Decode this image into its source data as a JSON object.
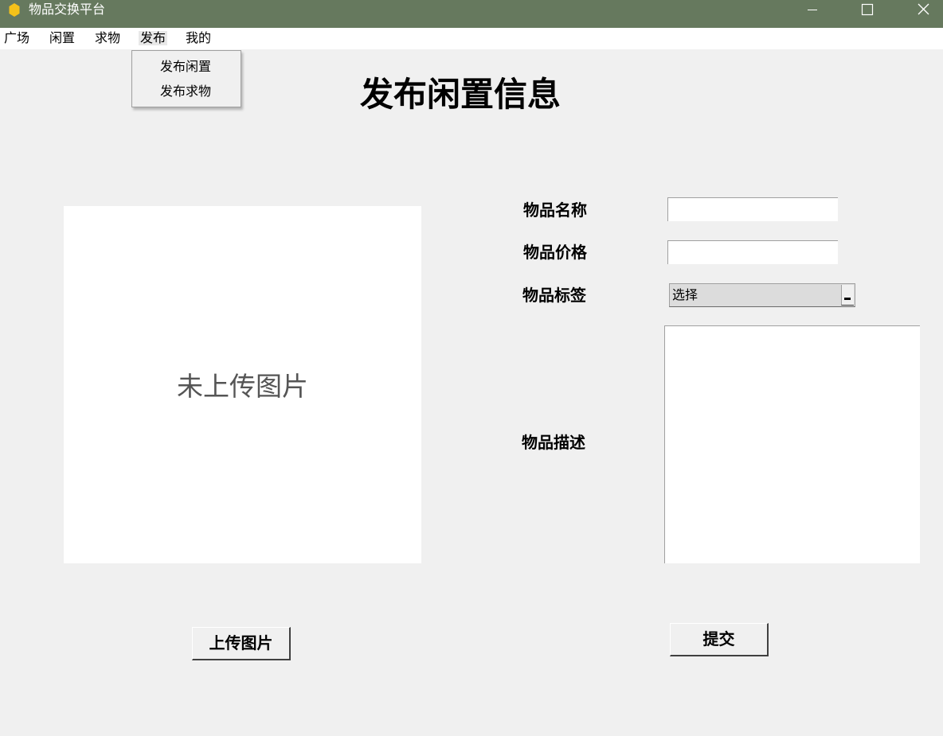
{
  "window": {
    "title": "物品交换平台",
    "icon": "hexagon-icon",
    "accent_color": "#66795e",
    "icon_color": "#f5c21a"
  },
  "menubar": {
    "items": [
      {
        "label": "广场"
      },
      {
        "label": "闲置"
      },
      {
        "label": "求物"
      },
      {
        "label": "发布",
        "active": true
      },
      {
        "label": "我的"
      }
    ]
  },
  "dropdown": {
    "items": [
      {
        "label": "发布闲置"
      },
      {
        "label": "发布求物"
      }
    ]
  },
  "page": {
    "title": "发布闲置信息",
    "image_placeholder": "未上传图片",
    "upload_button": "上传图片",
    "submit_button": "提交"
  },
  "form": {
    "name_label": "物品名称",
    "name_value": "",
    "price_label": "物品价格",
    "price_value": "",
    "tag_label": "物品标签",
    "tag_selected": "选择",
    "desc_label": "物品描述",
    "desc_value": ""
  }
}
